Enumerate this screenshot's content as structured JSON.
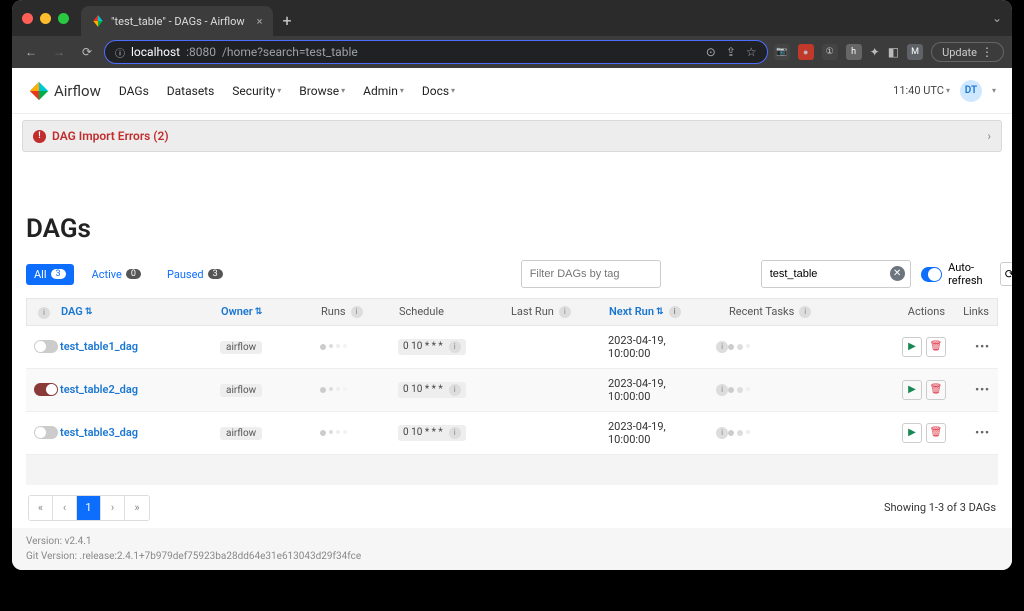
{
  "browser": {
    "tab_title": "\"test_table\" - DAGs - Airflow",
    "url_host": "localhost",
    "url_port": ":8080",
    "url_path": "/home?search=test_table",
    "update_label": "Update"
  },
  "nav": {
    "brand": "Airflow",
    "items": [
      "DAGs",
      "Datasets",
      "Security",
      "Browse",
      "Admin",
      "Docs"
    ],
    "clock": "11:40 UTC",
    "user_initials": "DT"
  },
  "alert": {
    "text": "DAG Import Errors (2)"
  },
  "page_title": "DAGs",
  "filters": {
    "all_label": "All",
    "all_count": "3",
    "active_label": "Active",
    "active_count": "0",
    "paused_label": "Paused",
    "paused_count": "3",
    "tag_placeholder": "Filter DAGs by tag",
    "search_value": "test_table",
    "auto_refresh_label": "Auto-refresh"
  },
  "columns": {
    "dag": "DAG",
    "owner": "Owner",
    "runs": "Runs",
    "schedule": "Schedule",
    "last_run": "Last Run",
    "next_run": "Next Run",
    "recent_tasks": "Recent Tasks",
    "actions": "Actions",
    "links": "Links"
  },
  "rows": [
    {
      "name": "test_table1_dag",
      "owner": "airflow",
      "schedule": "0 10 * * *",
      "next_run": "2023-04-19, 10:00:00",
      "on": false
    },
    {
      "name": "test_table2_dag",
      "owner": "airflow",
      "schedule": "0 10 * * *",
      "next_run": "2023-04-19, 10:00:00",
      "on": true
    },
    {
      "name": "test_table3_dag",
      "owner": "airflow",
      "schedule": "0 10 * * *",
      "next_run": "2023-04-19, 10:00:00",
      "on": false
    }
  ],
  "pagination": {
    "first": "«",
    "prev": "‹",
    "page": "1",
    "next": "›",
    "last": "»",
    "showing": "Showing 1-3 of 3 DAGs"
  },
  "footer": {
    "line1": "Version: v2.4.1",
    "line2": "Git Version: .release:2.4.1+7b979def75923ba28dd64e31e613043d29f34fce"
  }
}
